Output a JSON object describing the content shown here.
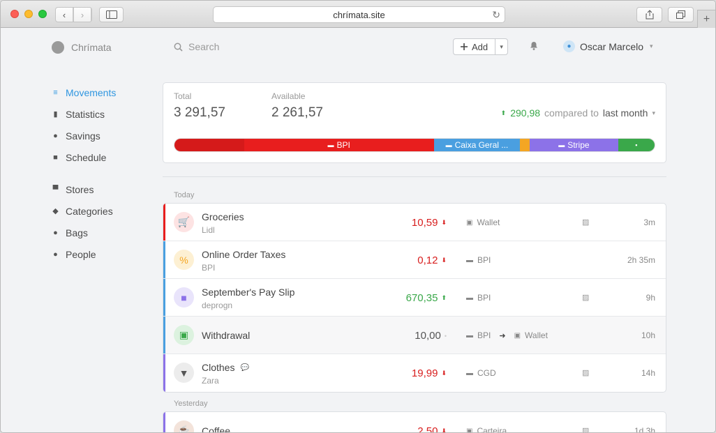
{
  "browser": {
    "url": "chrímata.site",
    "back_glyph": "‹",
    "forward_glyph": "›",
    "reload_glyph": "↻",
    "new_tab_glyph": "+"
  },
  "header": {
    "brand": "Chrímata",
    "search_placeholder": "Search",
    "add_label": "Add",
    "user_name": "Oscar Marcelo"
  },
  "sidebar": {
    "items": [
      {
        "label": "Movements",
        "icon": "movements-icon",
        "glyph": "≡",
        "active": true
      },
      {
        "label": "Statistics",
        "icon": "bar-chart-icon",
        "glyph": "▮",
        "active": false
      },
      {
        "label": "Savings",
        "icon": "piggy-bank-icon",
        "glyph": "●",
        "active": false
      },
      {
        "label": "Schedule",
        "icon": "schedule-icon",
        "glyph": "■",
        "active": false
      }
    ],
    "items2": [
      {
        "label": "Stores",
        "icon": "store-icon",
        "glyph": "▀",
        "active": false
      },
      {
        "label": "Categories",
        "icon": "tag-icon",
        "glyph": "◆",
        "active": false
      },
      {
        "label": "Bags",
        "icon": "bag-icon",
        "glyph": "●",
        "active": false
      },
      {
        "label": "People",
        "icon": "person-icon",
        "glyph": "●",
        "active": false
      }
    ]
  },
  "summary": {
    "total_label": "Total",
    "total_value": "3 291,57",
    "available_label": "Available",
    "available_value": "2 261,57",
    "delta": "290,98",
    "compared_to": "compared to",
    "period": "last month",
    "segments": [
      {
        "label": "",
        "color": "#d51a1a",
        "share": 0.145
      },
      {
        "label": "BPI",
        "color": "#e81e1e",
        "share": 0.395
      },
      {
        "label": "Caixa Geral ...",
        "color": "#4a9fe0",
        "share": 0.18
      },
      {
        "label": "",
        "color": "#f4a623",
        "share": 0.02
      },
      {
        "label": "Stripe",
        "color": "#8c72e8",
        "share": 0.184
      },
      {
        "label": "",
        "color": "#3aa84a",
        "share": 0.076
      }
    ]
  },
  "sections": {
    "today": "Today",
    "yesterday": "Yesterday"
  },
  "movements_today": [
    {
      "title": "Groceries",
      "subtitle": "Lidl",
      "amount": "10,59",
      "direction": "down",
      "account": "Wallet",
      "account_icon": "wallet-icon",
      "time": "3m",
      "accent": "#e81e1e",
      "circle_bg": "#fde3e3",
      "circle_fg": "#e81e1e",
      "icon": "basket-icon",
      "glyph": "🛒",
      "receipt": true
    },
    {
      "title": "Online Order Taxes",
      "subtitle": "BPI",
      "amount": "0,12",
      "direction": "down",
      "account": "BPI",
      "account_icon": "card-icon",
      "time": "2h 35m",
      "accent": "#4a9fe0",
      "circle_bg": "#fdf0d3",
      "circle_fg": "#f4a623",
      "icon": "percent-icon",
      "glyph": "%",
      "receipt": false
    },
    {
      "title": "September's Pay Slip",
      "subtitle": "deprogn",
      "amount": "670,35",
      "direction": "up",
      "account": "BPI",
      "account_icon": "card-icon",
      "time": "9h",
      "accent": "#4a9fe0",
      "circle_bg": "#e9e4fb",
      "circle_fg": "#8c72e8",
      "icon": "briefcase-icon",
      "glyph": "■",
      "receipt": true
    },
    {
      "title": "Withdrawal",
      "subtitle": "",
      "amount": "10,00",
      "direction": "neutral",
      "account": "BPI",
      "account_icon": "card-icon",
      "to_account": "Wallet",
      "time": "10h",
      "accent": "#4a9fe0",
      "circle_bg": "#dcf2df",
      "circle_fg": "#3aa84a",
      "icon": "cash-icon",
      "glyph": "▣",
      "receipt": false
    },
    {
      "title": "Clothes",
      "subtitle": "Zara",
      "amount": "19,99",
      "direction": "down",
      "account": "CGD",
      "account_icon": "card-icon",
      "time": "14h",
      "accent": "#8c72e8",
      "circle_bg": "#ececec",
      "circle_fg": "#555555",
      "icon": "shirt-icon",
      "glyph": "▼",
      "receipt": true,
      "has_comment": true
    }
  ],
  "movements_yesterday": [
    {
      "title": "Coffee",
      "subtitle": "",
      "amount": "2,50",
      "direction": "down",
      "account": "Carteira",
      "account_icon": "wallet-icon",
      "time": "1d 3h",
      "accent": "#8c72e8",
      "circle_bg": "#f3e3da",
      "circle_fg": "#8a4b2a",
      "icon": "coffee-icon",
      "glyph": "☕",
      "receipt": true
    }
  ]
}
